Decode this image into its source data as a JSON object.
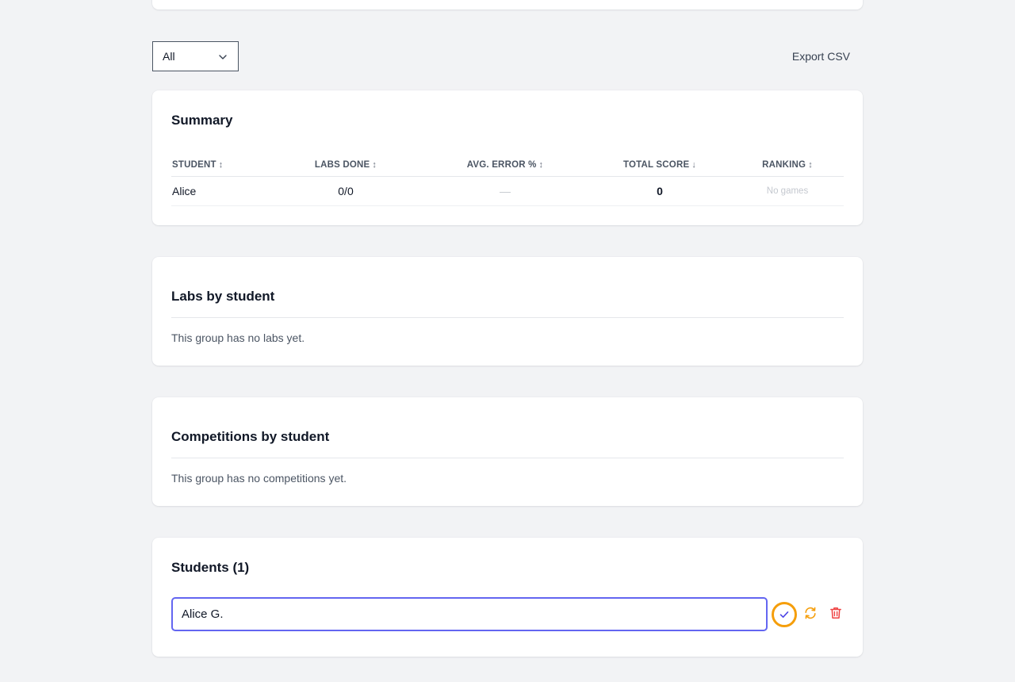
{
  "filter": {
    "selected": "All"
  },
  "toolbar": {
    "export_label": "Export CSV"
  },
  "summary": {
    "title": "Summary",
    "columns": [
      {
        "label": "STUDENT",
        "sort_glyph": "↕"
      },
      {
        "label": "LABS DONE",
        "sort_glyph": "↕"
      },
      {
        "label": "AVG. ERROR %",
        "sort_glyph": "↕"
      },
      {
        "label": "TOTAL SCORE",
        "sort_glyph": "↓"
      },
      {
        "label": "RANKING",
        "sort_glyph": "↕"
      }
    ],
    "rows": [
      {
        "student": "Alice",
        "labs_done": "0/0",
        "avg_error": "—",
        "total_score": "0",
        "ranking": "No games"
      }
    ]
  },
  "labs": {
    "title": "Labs by student",
    "empty": "This group has no labs yet."
  },
  "competitions": {
    "title": "Competitions by student",
    "empty": "This group has no competitions yet."
  },
  "students": {
    "title": "Students (1)",
    "edit_value": "Alice G."
  },
  "colors": {
    "accent_input": "#6366f1",
    "focus_ring": "#f59e0b",
    "refresh": "#f59e0b",
    "delete": "#ef4444",
    "check": "#4f46e5"
  },
  "icons": {
    "select": "chevron-down-icon",
    "confirm": "check-icon",
    "refresh": "refresh-icon",
    "delete": "trash-icon"
  }
}
